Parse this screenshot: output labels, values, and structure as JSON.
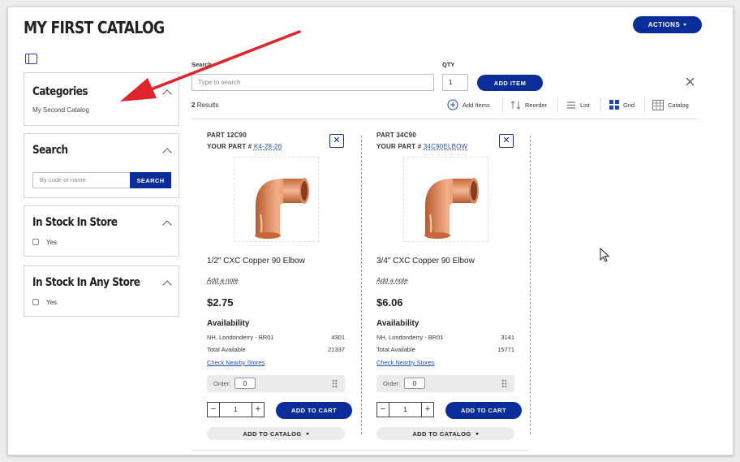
{
  "page": {
    "title": "MY FIRST CATALOG",
    "actions_label": "ACTIONS"
  },
  "filters": {
    "categories": {
      "title": "Categories",
      "item": "My Second Catalog"
    },
    "search": {
      "title": "Search",
      "placeholder": "By code or name",
      "button": "SEARCH"
    },
    "in_stock_store": {
      "title": "In Stock In Store",
      "option": "Yes"
    },
    "in_stock_any": {
      "title": "In Stock In Any Store",
      "option": "Yes"
    }
  },
  "add_bar": {
    "search_label": "Search",
    "search_placeholder": "Type to search",
    "qty_label": "QTY",
    "qty_value": "1",
    "add_button": "ADD ITEM"
  },
  "results": {
    "count": "2",
    "label": "Results"
  },
  "toolbar": {
    "add_items": "Add Items",
    "reorder": "Reorder",
    "list": "List",
    "grid": "Grid",
    "catalog": "Catalog"
  },
  "products": [
    {
      "part": "PART 12C90",
      "your_part_label": "YOUR PART #",
      "your_part": "K4-28-26",
      "name": "1/2\" CXC Copper 90 Elbow",
      "note": "Add a note",
      "price": "$2.75",
      "availability_title": "Availability",
      "store": "NH, Londonderry - BR01",
      "store_qty": "4301",
      "total_label": "Total Available",
      "total_qty": "21337",
      "nearby": "Check Nearby Stores",
      "order_label": "Order:",
      "order_value": "0",
      "qty": "1",
      "add_to_cart": "ADD TO CART",
      "add_to_catalog": "ADD TO CATALOG"
    },
    {
      "part": "PART 34C90",
      "your_part_label": "YOUR PART #",
      "your_part": "34C90ELBOW",
      "name": "3/4\" CXC Copper 90 Elbow",
      "note": "Add a note",
      "price": "$6.06",
      "availability_title": "Availability",
      "store": "NH, Londonderry - BR01",
      "store_qty": "3141",
      "total_label": "Total Available",
      "total_qty": "15771",
      "nearby": "Check Nearby Stores",
      "order_label": "Order:",
      "order_value": "0",
      "qty": "1",
      "add_to_cart": "ADD TO CART",
      "add_to_catalog": "ADD TO CATALOG"
    }
  ],
  "colors": {
    "primary": "#0b2d99",
    "link": "#1f4fb0",
    "annotation_arrow": "#e0242b",
    "copper": "#d9855a"
  },
  "icons": [
    "sidebar-toggle-icon",
    "chevron-up-icon",
    "close-icon",
    "plus-circle-icon",
    "reorder-icon",
    "list-icon",
    "grid-icon",
    "catalog-icon",
    "drag-handle-icon",
    "caret-down-icon",
    "mouse-cursor-icon",
    "red-arrow-annotation"
  ]
}
